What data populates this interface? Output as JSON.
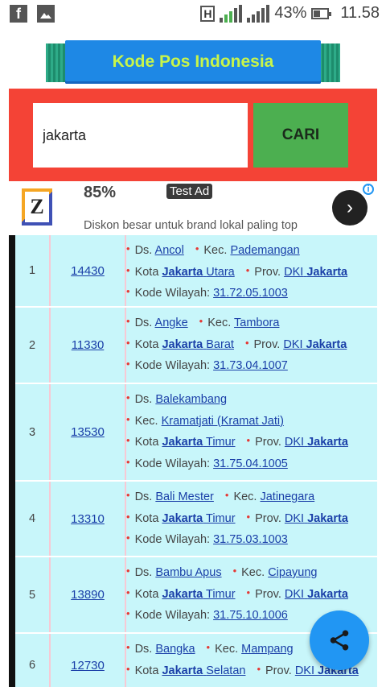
{
  "status_bar": {
    "signal_sim1": "1",
    "signal_sim2": "2",
    "network_type": "H",
    "battery": "43%",
    "time": "11.58"
  },
  "banner": {
    "title": "Kode Pos Indonesia"
  },
  "search": {
    "value": "jakarta",
    "button_label": "CARI"
  },
  "ad": {
    "logo_letter": "Z",
    "discount": "85%",
    "label": "Test Ad",
    "description": "Diskon besar untuk brand lokal paling top",
    "info": "i"
  },
  "results": [
    {
      "no": "1",
      "zip": "14430",
      "desa_prefix": "Ds.",
      "desa": "Ancol",
      "kec_prefix": "Kec.",
      "kec": "Pademangan",
      "kota_prefix": "Kota",
      "kota_a": "Jakarta",
      "kota_b": "Utara",
      "prov_prefix": "Prov.",
      "prov_a": "DKI",
      "prov_b": "Jakarta",
      "wilayah_prefix": "Kode Wilayah:",
      "wilayah": "31.72.05.1003"
    },
    {
      "no": "2",
      "zip": "11330",
      "desa_prefix": "Ds.",
      "desa": "Angke",
      "kec_prefix": "Kec.",
      "kec": "Tambora",
      "kota_prefix": "Kota",
      "kota_a": "Jakarta",
      "kota_b": "Barat",
      "prov_prefix": "Prov.",
      "prov_a": "DKI",
      "prov_b": "Jakarta",
      "wilayah_prefix": "Kode Wilayah:",
      "wilayah": "31.73.04.1007"
    },
    {
      "no": "3",
      "zip": "13530",
      "desa_prefix": "Ds.",
      "desa": "Balekambang",
      "kec_prefix": "Kec.",
      "kec": "Kramatjati (Kramat Jati)",
      "kota_prefix": "Kota",
      "kota_a": "Jakarta",
      "kota_b": "Timur",
      "prov_prefix": "Prov.",
      "prov_a": "DKI",
      "prov_b": "Jakarta",
      "wilayah_prefix": "Kode Wilayah:",
      "wilayah": "31.75.04.1005"
    },
    {
      "no": "4",
      "zip": "13310",
      "desa_prefix": "Ds.",
      "desa": "Bali Mester",
      "kec_prefix": "Kec.",
      "kec": "Jatinegara",
      "kota_prefix": "Kota",
      "kota_a": "Jakarta",
      "kota_b": "Timur",
      "prov_prefix": "Prov.",
      "prov_a": "DKI",
      "prov_b": "Jakarta",
      "wilayah_prefix": "Kode Wilayah:",
      "wilayah": "31.75.03.1003"
    },
    {
      "no": "5",
      "zip": "13890",
      "desa_prefix": "Ds.",
      "desa": "Bambu Apus",
      "kec_prefix": "Kec.",
      "kec": "Cipayung",
      "kota_prefix": "Kota",
      "kota_a": "Jakarta",
      "kota_b": "Timur",
      "prov_prefix": "Prov.",
      "prov_a": "DKI",
      "prov_b": "Jakarta",
      "wilayah_prefix": "Kode Wilayah:",
      "wilayah": "31.75.10.1006"
    },
    {
      "no": "6",
      "zip": "12730",
      "desa_prefix": "Ds.",
      "desa": "Bangka",
      "kec_prefix": "Kec.",
      "kec": "Mampang",
      "kota_prefix": "Kota",
      "kota_a": "Jakarta",
      "kota_b": "Selatan",
      "prov_prefix": "Prov.",
      "prov_a": "DKI",
      "prov_b": "Jakarta",
      "wilayah_prefix": "",
      "wilayah": ""
    }
  ],
  "fab": {
    "icon": "share-icon"
  },
  "colors": {
    "search_panel": "#f44336",
    "search_button": "#4caf50",
    "banner": "#1e88e5",
    "banner_text": "#c8f54a",
    "table_bg": "#c8f6fa",
    "fab": "#2196f3"
  }
}
